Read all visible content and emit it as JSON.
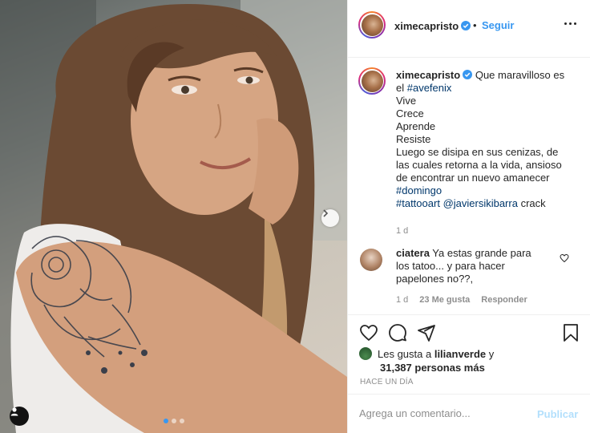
{
  "header": {
    "username": "ximecapristo",
    "separator": "•",
    "follow_label": "Seguir"
  },
  "caption": {
    "username": "ximecapristo",
    "lines": [
      {
        "text": "Que maravilloso es"
      },
      {
        "pre": "el ",
        "tag": "#avefenix"
      },
      {
        "text": "Vive"
      },
      {
        "text": "Crece"
      },
      {
        "text": "Aprende"
      },
      {
        "text": "Resiste"
      },
      {
        "text": "Luego se disipa en sus cenizas, de"
      },
      {
        "text": "las cuales retorna a la vida, ansioso"
      },
      {
        "text": "de encontrar un nuevo amanecer"
      },
      {
        "tag": "#domingo"
      },
      {
        "tag": "#tattooart",
        "tag2": "@javiersikibarra",
        "post": " crack"
      }
    ],
    "time": "1 d"
  },
  "reply": {
    "username": "ciatera",
    "text_1": " Ya estas grande para",
    "text_2": "los tatoo... y para hacer",
    "text_3": "papelones no??,",
    "time": "1 d",
    "likes": "23 Me gusta",
    "reply_label": "Responder"
  },
  "likes": {
    "prefix": "Les gusta a ",
    "user": "lilianverde",
    "suffix": " y",
    "count_text": "31,387 personas más"
  },
  "timestamp": "HACE UN DÍA",
  "add_comment": {
    "placeholder": "Agrega un comentario...",
    "post_label": "Publicar"
  },
  "colors": {
    "accent": "#3897f0",
    "tag": "#00376b",
    "muted": "#8e8e8e",
    "post_disabled": "#b2dffc"
  },
  "icons": [
    "heart-icon",
    "comment-icon",
    "share-icon",
    "bookmark-icon",
    "verified-icon",
    "more-icon",
    "chevron-right-icon",
    "user-tag-icon"
  ],
  "carousel": {
    "count": 3,
    "active": 1
  }
}
